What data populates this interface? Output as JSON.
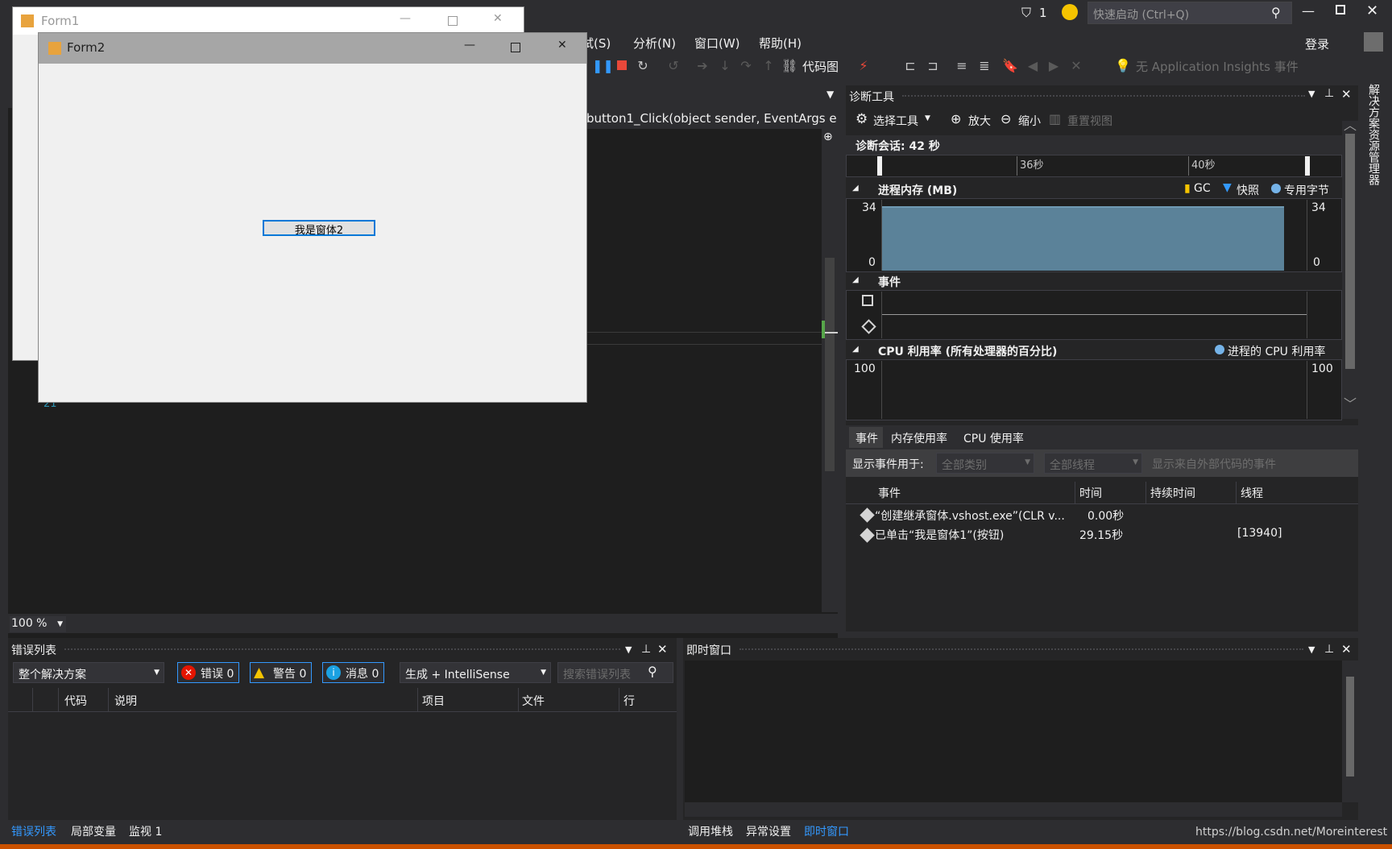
{
  "titlebar": {
    "notifications": "1",
    "quick_launch_placeholder": "快速启动 (Ctrl+Q)",
    "login": "登录"
  },
  "menu": {
    "items": [
      "试(S)",
      "分析(N)",
      "窗口(W)",
      "帮助(H)"
    ]
  },
  "toolbar": {
    "code_map": "代码图",
    "app_insights": "无 Application Insights 事件"
  },
  "editor": {
    "nav_member": "button1_Click(object sender, EventArgs e",
    "zoom": "100 %",
    "line_number": "21"
  },
  "form1": {
    "title": "Form1"
  },
  "form2": {
    "title": "Form2",
    "button_label": "我是窗体2"
  },
  "diag": {
    "title": "诊断工具",
    "select_tool": "选择工具",
    "zoom_in": "放大",
    "zoom_out": "缩小",
    "reset_view": "重置视图",
    "session": "诊断会话: 42 秒",
    "ticks": [
      "36秒",
      "40秒"
    ],
    "memory": {
      "header": "进程内存 (MB)",
      "legend": [
        "GC",
        "快照",
        "专用字节"
      ],
      "max": "34",
      "min": "0",
      "max_r": "34",
      "min_r": "0"
    },
    "events_header": "事件",
    "cpu": {
      "header": "CPU 利用率 (所有处理器的百分比)",
      "legend": "进程的 CPU 利用率",
      "max": "100",
      "max_r": "100"
    },
    "tabs": [
      "事件",
      "内存使用率",
      "CPU 使用率"
    ],
    "filter_label": "显示事件用于:",
    "filter_category": "全部类别",
    "filter_thread": "全部线程",
    "external_code": "显示来自外部代码的事件",
    "columns": [
      "事件",
      "时间",
      "持续时间",
      "线程"
    ],
    "rows": [
      {
        "event": "“创建继承窗体.vshost.exe”(CLR v...",
        "time": "0.00秒",
        "duration": "",
        "thread": ""
      },
      {
        "event": "已单击“我是窗体1”(按钮)",
        "time": "29.15秒",
        "duration": "",
        "thread": "[13940]"
      }
    ]
  },
  "side": {
    "solution_explorer": "解决方案资源管理器"
  },
  "errors": {
    "title": "错误列表",
    "scope": "整个解决方案",
    "errors_btn": "错误 0",
    "warnings_btn": "警告 0",
    "messages_btn": "消息 0",
    "build_filter": "生成 + IntelliSense",
    "search_placeholder": "搜索错误列表",
    "columns": [
      "代码",
      "说明",
      "项目",
      "文件",
      "行"
    ]
  },
  "immediate": {
    "title": "即时窗口"
  },
  "bottom_tabs_left": [
    "错误列表",
    "局部变量",
    "监视 1"
  ],
  "bottom_tabs_right": [
    "调用堆栈",
    "异常设置",
    "即时窗口"
  ],
  "watermark": "https://blog.csdn.net/Moreinterest",
  "colors": {
    "accent": "#3399ff",
    "memory_fill": "#5b8299",
    "status_bar": "#ca5100"
  }
}
